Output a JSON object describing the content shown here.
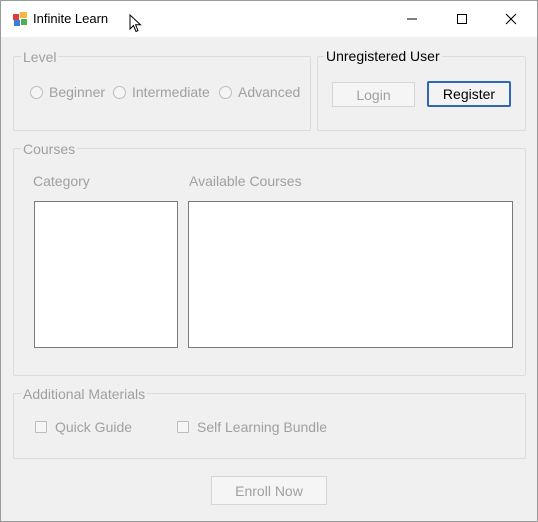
{
  "window": {
    "title": "Infinite Learn"
  },
  "level": {
    "legend": "Level",
    "options": [
      "Beginner",
      "Intermediate",
      "Advanced"
    ]
  },
  "user": {
    "legend": "Unregistered User",
    "login_label": "Login",
    "register_label": "Register"
  },
  "courses": {
    "legend": "Courses",
    "category_label": "Category",
    "available_label": "Available Courses"
  },
  "materials": {
    "legend": "Additional Materials",
    "quick_guide": "Quick Guide",
    "self_learning": "Self Learning Bundle"
  },
  "enroll": {
    "label": "Enroll Now"
  },
  "colors": {
    "accent": "#2f67b5",
    "disabled_text": "#a0a0a0"
  }
}
